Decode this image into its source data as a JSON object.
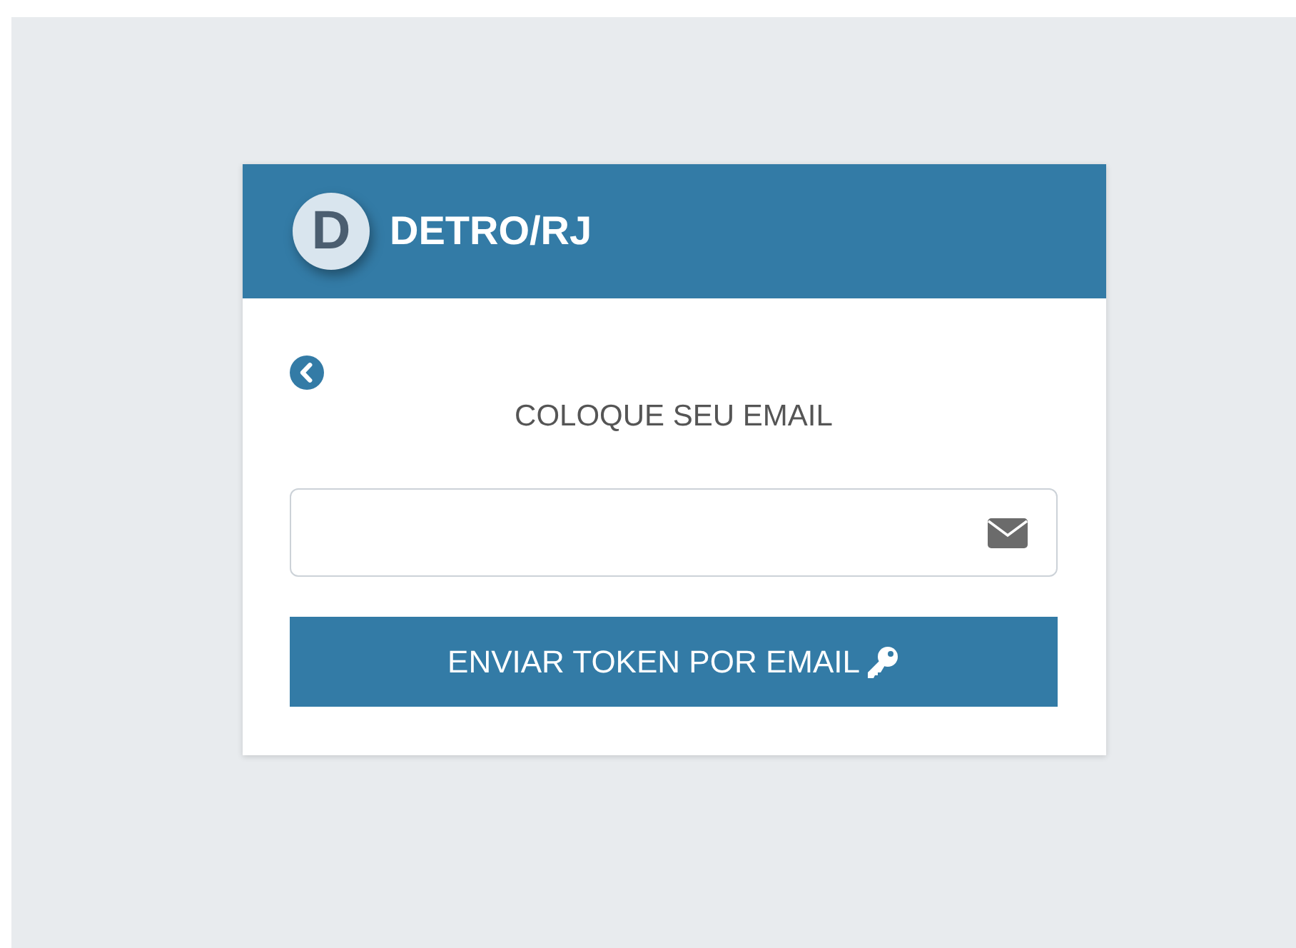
{
  "header": {
    "logo_letter": "D",
    "title": "DETRO/RJ"
  },
  "form": {
    "heading": "COLOQUE SEU EMAIL",
    "submit_button": {
      "label": "ENVIAR TOKEN POR EMAIL"
    }
  }
}
